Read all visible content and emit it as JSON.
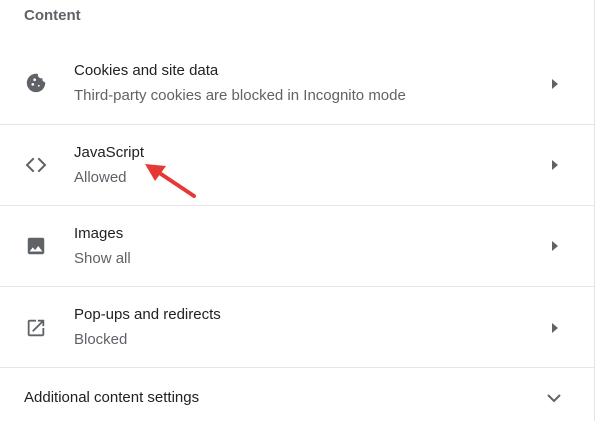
{
  "section": {
    "title": "Content"
  },
  "rows": [
    {
      "title": "Cookies and site data",
      "subtitle": "Third-party cookies are blocked in Incognito mode",
      "icon": "cookie-icon"
    },
    {
      "title": "JavaScript",
      "subtitle": "Allowed",
      "icon": "code-brackets-icon"
    },
    {
      "title": "Images",
      "subtitle": "Show all",
      "icon": "image-icon"
    },
    {
      "title": "Pop-ups and redirects",
      "subtitle": "Blocked",
      "icon": "open-in-new-icon"
    }
  ],
  "additional": {
    "label": "Additional content settings",
    "icon": "chevron-down-icon"
  },
  "annotation": {
    "icon": "red-arrow-annotation",
    "color": "#e53935"
  },
  "colors": {
    "title_text": "#202124",
    "secondary_text": "#5f6368",
    "divider": "#e6e6e6"
  }
}
